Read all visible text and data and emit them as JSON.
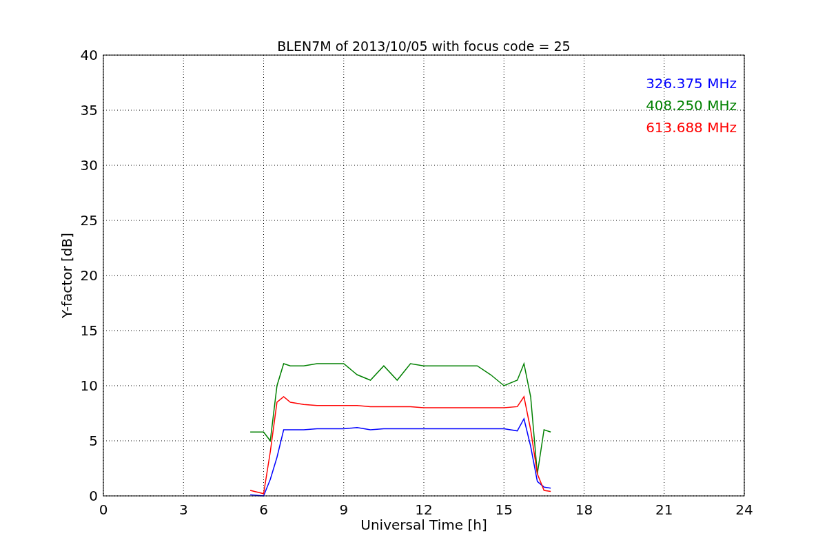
{
  "chart_data": {
    "type": "line",
    "title": "BLEN7M of 2013/10/05 with focus code = 25",
    "xlabel": "Universal Time [h]",
    "ylabel": "Y-factor [dB]",
    "x": [
      5.5,
      6,
      6.25,
      6.5,
      6.75,
      7,
      7.5,
      8,
      8.5,
      9,
      9.5,
      10,
      10.5,
      11,
      11.5,
      12,
      12.5,
      13,
      13.5,
      14,
      14.5,
      15,
      15.5,
      15.75,
      16,
      16.25,
      16.5,
      16.75
    ],
    "series": [
      {
        "name": "326.375 MHz",
        "color": "#0000ff",
        "values": [
          0.1,
          0.0,
          1.5,
          3.5,
          6,
          6,
          6,
          6.1,
          6.1,
          6.1,
          6.2,
          6,
          6.1,
          6.1,
          6.1,
          6.1,
          6.1,
          6.1,
          6.1,
          6.1,
          6.1,
          6.1,
          5.9,
          7,
          4.5,
          1.3,
          0.8,
          0.7
        ]
      },
      {
        "name": "408.250 MHz",
        "color": "#008000",
        "values": [
          5.8,
          5.8,
          5,
          10,
          12,
          11.8,
          11.8,
          12,
          12,
          12,
          11,
          10.5,
          11.8,
          10.5,
          12,
          11.8,
          11.8,
          11.8,
          11.8,
          11.8,
          11,
          10,
          10.5,
          12,
          9,
          2,
          6,
          5.8
        ]
      },
      {
        "name": "613.688 MHz",
        "color": "#ff0000",
        "values": [
          0.5,
          0.2,
          4,
          8.5,
          9,
          8.5,
          8.3,
          8.2,
          8.2,
          8.2,
          8.2,
          8.1,
          8.1,
          8.1,
          8.1,
          8,
          8,
          8,
          8,
          8,
          8,
          8,
          8.1,
          9,
          6,
          2,
          0.5,
          0.4
        ]
      }
    ],
    "xlim": [
      0,
      24
    ],
    "ylim": [
      0,
      40
    ],
    "xticks": [
      0,
      3,
      6,
      9,
      12,
      15,
      18,
      21,
      24
    ],
    "yticks": [
      0,
      5,
      10,
      15,
      20,
      25,
      30,
      35,
      40
    ],
    "grid": true
  }
}
